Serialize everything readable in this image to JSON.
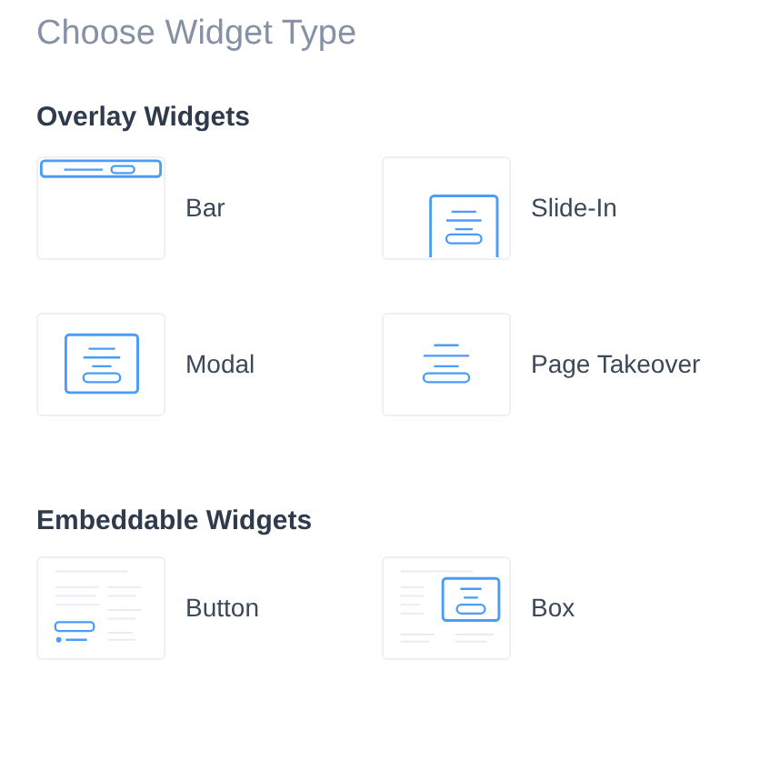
{
  "title": "Choose Widget Type",
  "sections": [
    {
      "heading": "Overlay Widgets",
      "widgets": [
        {
          "kind": "bar",
          "label": "Bar"
        },
        {
          "kind": "slidein",
          "label": "Slide-In"
        },
        {
          "kind": "modal",
          "label": "Modal"
        },
        {
          "kind": "takeover",
          "label": "Page Takeover"
        }
      ]
    },
    {
      "heading": "Embeddable Widgets",
      "widgets": [
        {
          "kind": "button",
          "label": "Button"
        },
        {
          "kind": "box",
          "label": "Box"
        }
      ]
    }
  ]
}
